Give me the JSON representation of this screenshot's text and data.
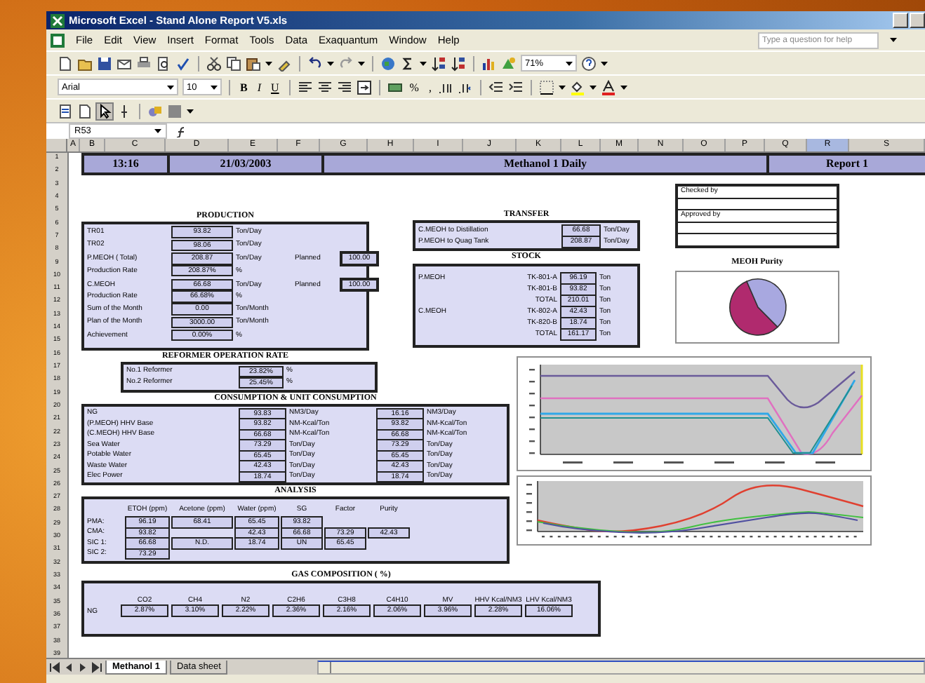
{
  "window": {
    "title": "Microsoft Excel - Stand Alone Report V5.xls"
  },
  "menu": [
    "File",
    "Edit",
    "View",
    "Insert",
    "Format",
    "Tools",
    "Data",
    "Exaquantum",
    "Window",
    "Help"
  ],
  "help_box": {
    "placeholder": "Type a question for help"
  },
  "toolbar": {
    "zoom": "71%",
    "font": "Arial",
    "font_size": "10",
    "format_buttons": [
      "B",
      "I",
      "U"
    ],
    "percent": "%",
    "comma": ","
  },
  "formula_bar": {
    "name_box": "R53"
  },
  "columns": [
    {
      "label": "A",
      "selected": false
    },
    {
      "label": "B",
      "selected": false
    },
    {
      "label": "C",
      "selected": false
    },
    {
      "label": "D",
      "selected": false
    },
    {
      "label": "E",
      "selected": false
    },
    {
      "label": "F",
      "selected": false
    },
    {
      "label": "G",
      "selected": false
    },
    {
      "label": "H",
      "selected": false
    },
    {
      "label": "I",
      "selected": false
    },
    {
      "label": "J",
      "selected": false
    },
    {
      "label": "K",
      "selected": false
    },
    {
      "label": "L",
      "selected": false
    },
    {
      "label": "M",
      "selected": false
    },
    {
      "label": "N",
      "selected": false
    },
    {
      "label": "O",
      "selected": false
    },
    {
      "label": "P",
      "selected": false
    },
    {
      "label": "Q",
      "selected": false
    },
    {
      "label": "R",
      "selected": true
    },
    {
      "label": "S",
      "selected": false
    }
  ],
  "row_numbers": [
    "1",
    "2",
    "3",
    "4",
    "5",
    "6",
    "7",
    "8",
    "9",
    "10",
    "11",
    "12",
    "13",
    "14",
    "15",
    "16",
    "17",
    "18",
    "19",
    "20",
    "21",
    "22",
    "23",
    "24",
    "25",
    "26",
    "27",
    "28",
    "29",
    "30",
    "31",
    "32",
    "33",
    "34",
    "35",
    "36",
    "37",
    "38",
    "39"
  ],
  "header": {
    "time": "13:16",
    "date": "21/03/2003",
    "title": "Methanol 1 Daily",
    "report": "Report 1"
  },
  "production": {
    "title": "PRODUCTION",
    "rows": [
      {
        "label": "TR01",
        "value": "93.82",
        "unit": "Ton/Day"
      },
      {
        "label": "TR02",
        "value": "98.06",
        "unit": "Ton/Day"
      },
      {
        "label": "P.MEOH ( Total)",
        "value": "208.87",
        "unit": "Ton/Day",
        "planned_label": "Planned",
        "planned": "100.00"
      },
      {
        "label": "Production Rate",
        "value": "208.87%",
        "unit": "%"
      },
      {
        "label": "C.MEOH",
        "value": "66.68",
        "unit": "Ton/Day",
        "planned_label": "Planned",
        "planned": "100.00"
      },
      {
        "label": "Production Rate",
        "value": "66.68%",
        "unit": "%"
      },
      {
        "label": "Sum of the Month",
        "value": "0.00",
        "unit": "Ton/Month"
      },
      {
        "label": "Plan of the Month",
        "value": "3000.00",
        "unit": "Ton/Month"
      },
      {
        "label": "Achievement",
        "value": "0.00%",
        "unit": "%"
      }
    ]
  },
  "transfer": {
    "title": "TRANSFER",
    "rows": [
      {
        "label": "C.MEOH to Distillation",
        "value": "66.68",
        "unit": "Ton/Day"
      },
      {
        "label": "P.MEOH to Quag Tank",
        "value": "208.87",
        "unit": "Ton/Day"
      }
    ]
  },
  "stock": {
    "title": "STOCK",
    "rows": [
      {
        "group": "P.MEOH",
        "tank": "TK-801-A",
        "value": "96.19",
        "unit": "Ton"
      },
      {
        "tank": "TK-801-B",
        "value": "93.82",
        "unit": "Ton"
      },
      {
        "tank": "TOTAL",
        "value": "210.01",
        "unit": "Ton"
      },
      {
        "group": "C.MEOH",
        "tank": "TK-802-A",
        "value": "42.43",
        "unit": "Ton"
      },
      {
        "tank": "TK-820-B",
        "value": "18.74",
        "unit": "Ton"
      },
      {
        "tank": "TOTAL",
        "value": "161.17",
        "unit": "Ton"
      }
    ]
  },
  "signoff": {
    "checked_label": "Checked by",
    "approved_label": "Approved by"
  },
  "purity_chart": {
    "title": "MEOH Purity"
  },
  "reformer": {
    "title": "REFORMER OPERATION RATE",
    "rows": [
      {
        "label": "No.1 Reformer",
        "value": "23.82%",
        "unit": "%"
      },
      {
        "label": "No.2 Reformer",
        "value": "25.45%",
        "unit": "%"
      }
    ]
  },
  "consumption": {
    "title": "CONSUMPTION & UNIT CONSUMPTION",
    "rows": [
      {
        "label": "NG",
        "value": "93.83",
        "unit": "NM3/Day",
        "value_2": "16.16",
        "unit_2": "NM3/Day"
      },
      {
        "label": "(P.MEOH) HHV Base",
        "value": "93.82",
        "unit": "NM-Kcal/Ton",
        "value_2": "93.82",
        "unit_2": "NM-Kcal/Ton"
      },
      {
        "label": "(C.MEOH) HHV Base",
        "value": "66.68",
        "unit": "NM-Kcal/Ton",
        "value_2": "66.68",
        "unit_2": "NM-Kcal/Ton"
      },
      {
        "label": "Sea Water",
        "value": "73.29",
        "unit": "Ton/Day",
        "value_2": "73.29",
        "unit_2": "Ton/Day"
      },
      {
        "label": "Potable Water",
        "value": "65.45",
        "unit": "Ton/Day",
        "value_2": "65.45",
        "unit_2": "Ton/Day"
      },
      {
        "label": "Waste Water",
        "value": "42.43",
        "unit": "Ton/Day",
        "value_2": "42.43",
        "unit_2": "Ton/Day"
      },
      {
        "label": "Elec Power",
        "value": "18.74",
        "unit": "Ton/Day",
        "value_2": "18.74",
        "unit_2": "Ton/Day"
      }
    ]
  },
  "analysis": {
    "title": "ANALYSIS",
    "columns": [
      "ETOH (ppm)",
      "Acetone (ppm)",
      "Water (ppm)",
      "SG",
      "Factor",
      "Purity"
    ],
    "rows": [
      {
        "label": "PMA:",
        "cells": [
          "96.19",
          "68.41",
          "65.45",
          "93.82",
          "",
          ""
        ]
      },
      {
        "label": "CMA:",
        "cells": [
          "93.82",
          "",
          "42.43",
          "66.68",
          "73.29",
          "42.43"
        ]
      },
      {
        "label": "SIC 1:",
        "cells": [
          "66.68",
          "N.D.",
          "18.74",
          "UN",
          "65.45",
          ""
        ]
      },
      {
        "label": "SIC 2:",
        "cells": [
          "73.29",
          "",
          "",
          "",
          "",
          ""
        ]
      }
    ]
  },
  "gas_composition": {
    "title": "GAS COMPOSITION ( %)",
    "row_label": "NG",
    "columns": [
      {
        "name": "CO2",
        "value": "2.87%"
      },
      {
        "name": "CH4",
        "value": "3.10%"
      },
      {
        "name": "N2",
        "value": "2.22%"
      },
      {
        "name": "C2H6",
        "value": "2.36%"
      },
      {
        "name": "C3H8",
        "value": "2.16%"
      },
      {
        "name": "C4H10",
        "value": "2.06%"
      },
      {
        "name": "MV",
        "value": "3.96%"
      },
      {
        "name": "HHV Kcal/NM3",
        "value": "2.28%"
      },
      {
        "name": "LHV Kcal/NM3",
        "value": "16.06%"
      }
    ]
  },
  "sheet_tabs": [
    {
      "label": "Methanol 1",
      "selected": true
    },
    {
      "label": "Data sheet",
      "selected": false
    }
  ]
}
